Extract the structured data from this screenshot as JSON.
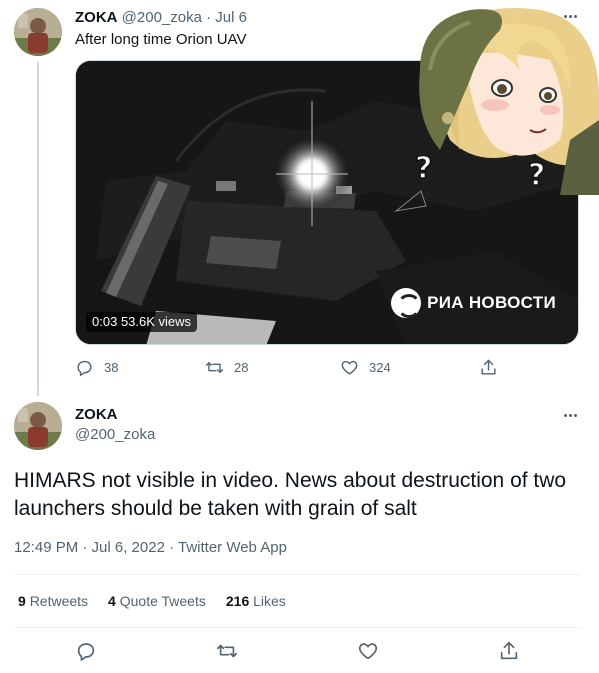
{
  "parent_tweet": {
    "name": "ZOKA",
    "handle": "@200_zoka",
    "separator": "·",
    "date": "Jul 6",
    "text": "After long time Orion UAV",
    "media": {
      "time": "0:03",
      "views": "53.6K views",
      "watermark": "РИА НОВОСТИ"
    },
    "actions": {
      "replies": "38",
      "retweets": "28",
      "likes": "324"
    }
  },
  "main_tweet": {
    "name": "ZOKA",
    "handle": "@200_zoka",
    "text": "HIMARS not visible in video. News about destruction of two launchers should be taken with grain of salt",
    "meta": "12:49 PM · Jul 6, 2022 · Twitter Web App",
    "stats": {
      "retweets_count": "9",
      "retweets_label": "Retweets",
      "quotes_count": "4",
      "quotes_label": "Quote Tweets",
      "likes_count": "216",
      "likes_label": "Likes"
    }
  },
  "icons": {
    "reply": "reply-icon",
    "retweet": "retweet-icon",
    "like": "heart-icon",
    "share": "share-icon",
    "more": "more-icon"
  }
}
